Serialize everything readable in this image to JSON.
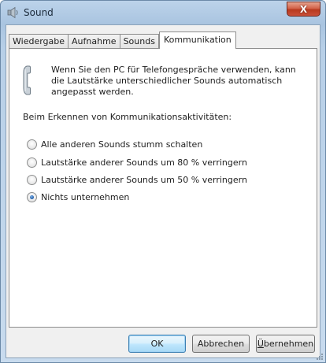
{
  "window": {
    "title": "Sound",
    "icon": "speaker-icon",
    "close_label": "X"
  },
  "tabs": [
    {
      "label": "Wiedergabe",
      "active": false
    },
    {
      "label": "Aufnahme",
      "active": false
    },
    {
      "label": "Sounds",
      "active": false
    },
    {
      "label": "Kommunikation",
      "active": true
    }
  ],
  "panel": {
    "info_icon": "telephone-icon",
    "info_text": "Wenn Sie den PC für Telefongespräche verwenden, kann die Lautstärke unterschiedlicher Sounds automatisch angepasst werden.",
    "detect_label": "Beim Erkennen von Kommunikationsaktivitäten:",
    "options": [
      {
        "label": "Alle anderen Sounds stumm schalten",
        "checked": false
      },
      {
        "label": "Lautstärke anderer Sounds um 80 % verringern",
        "checked": false
      },
      {
        "label": "Lautstärke anderer Sounds um 50 % verringern",
        "checked": false
      },
      {
        "label": "Nichts unternehmen",
        "checked": true
      }
    ]
  },
  "buttons": {
    "ok": "OK",
    "cancel": "Abbrechen",
    "apply_first": "Ü",
    "apply_rest": "bernehmen"
  },
  "colors": {
    "frame": "#a9c4e0",
    "close": "#c9503a",
    "accent": "#1d5aa8"
  }
}
